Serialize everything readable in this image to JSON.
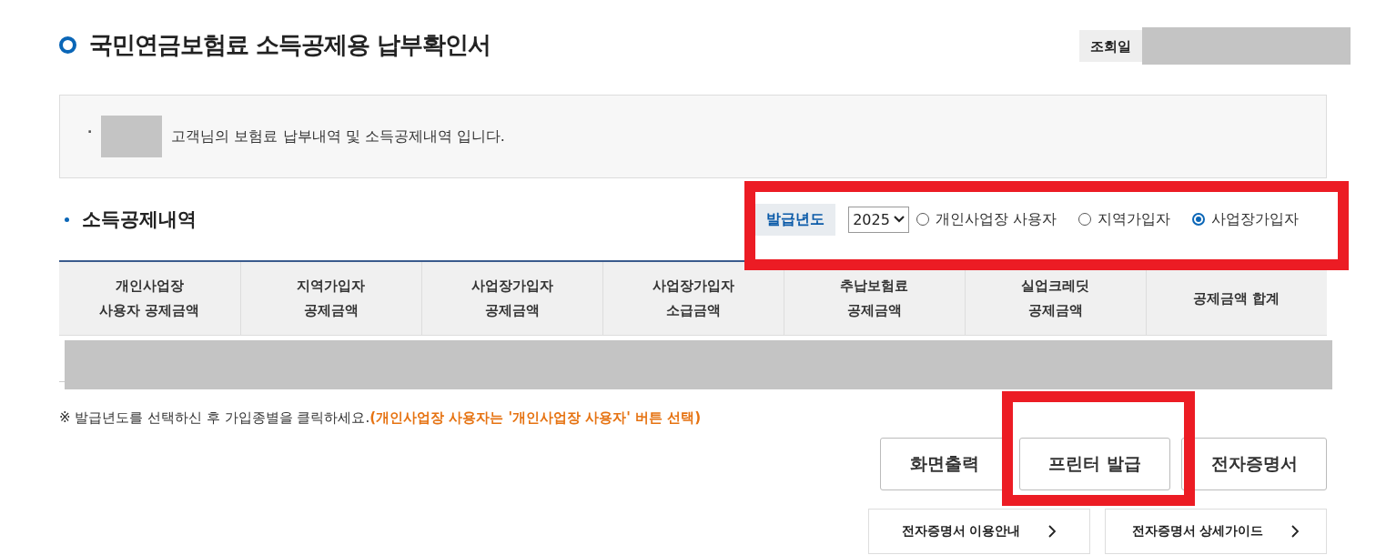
{
  "title": "국민연금보험료 소득공제용 납부확인서",
  "query_date": {
    "label": "조회일"
  },
  "notice": {
    "bullet": "·",
    "text": "고객님의 보험료 납부내역 및 소득공제내역 입니다."
  },
  "section": {
    "title": "소득공제내역"
  },
  "filter": {
    "label": "발급년도",
    "year": "2025",
    "options": [
      {
        "label": "개인사업장 사용자",
        "selected": false
      },
      {
        "label": "지역가입자",
        "selected": false
      },
      {
        "label": "사업장가입자",
        "selected": true
      }
    ]
  },
  "table": {
    "columns": [
      "개인사업장\n사용자 공제금액",
      "지역가입자\n공제금액",
      "사업장가입자\n공제금액",
      "사업장가입자\n소급금액",
      "추납보험료\n공제금액",
      "실업크레딧\n공제금액",
      "공제금액 합계"
    ]
  },
  "note": {
    "text": "※ 발급년도를 선택하신 후 가입종별을 클릭하세요.",
    "highlight": "(개인사업장 사용자는 '개인사업장 사용자' 버튼 선택)"
  },
  "buttons": [
    "화면출력",
    "프린터 발급",
    "전자증명서"
  ],
  "links": [
    "전자증명서 이용안내",
    "전자증명서 상세가이드"
  ]
}
